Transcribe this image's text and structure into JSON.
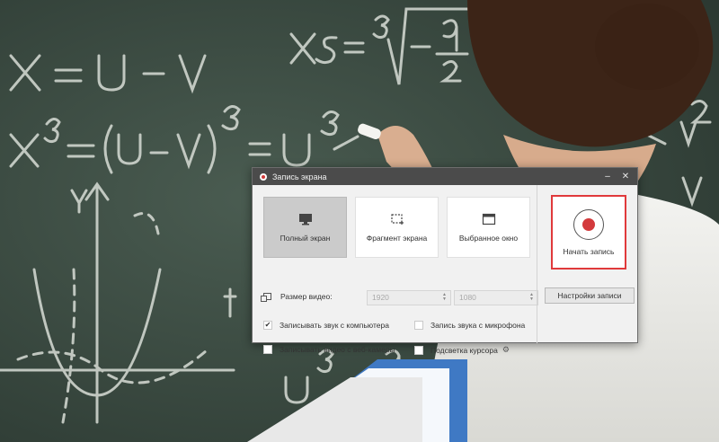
{
  "window": {
    "title": "Запись экрана",
    "minimize": "–",
    "close": "✕"
  },
  "modes": [
    {
      "label": "Полный экран",
      "icon": "monitor-icon",
      "active": true
    },
    {
      "label": "Фрагмент экрана",
      "icon": "crop-fragment-icon",
      "active": false
    },
    {
      "label": "Выбранное окно",
      "icon": "window-icon",
      "active": false
    }
  ],
  "video_size": {
    "label": "Размер видео:",
    "width": "1920",
    "height": "1080"
  },
  "options": {
    "system_audio": {
      "label": "Записывать звук с компьютера",
      "checked": true
    },
    "microphone": {
      "label": "Запись звука с микрофона",
      "checked": false
    },
    "webcam": {
      "label": "Записывать видео с веб-камеры",
      "checked": false
    },
    "cursor": {
      "label": "Подсветка курсора",
      "checked": false
    }
  },
  "record_button": {
    "label": "Начать запись",
    "accent": "#e0393b"
  },
  "settings_button": {
    "label": "Настройки записи"
  }
}
